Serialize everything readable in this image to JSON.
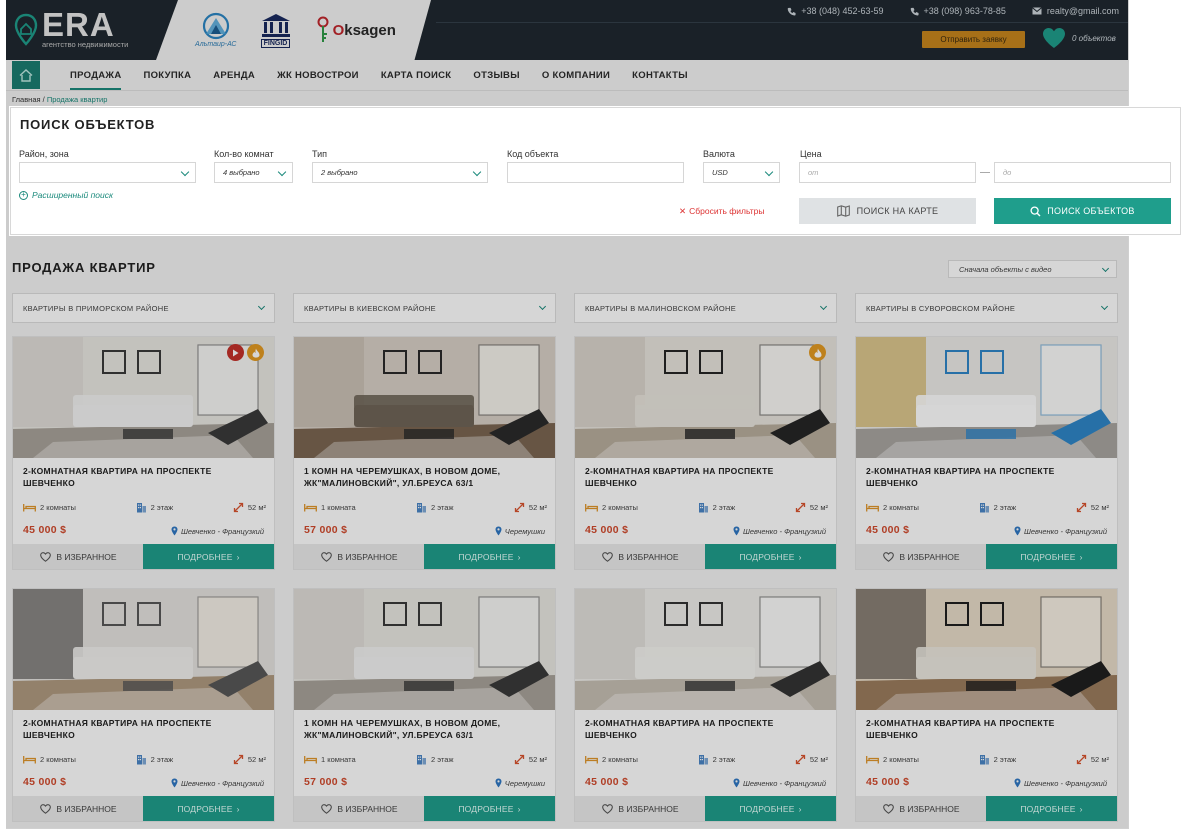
{
  "header": {
    "logo_word": "ERA",
    "logo_sub": "агентство недвижимости",
    "partners": [
      {
        "name": "Альтаир-АС"
      },
      {
        "name": "FINGID"
      },
      {
        "name": "Oksagen"
      }
    ],
    "contacts": [
      {
        "icon": "phone-icon",
        "text": "+38 (048) 452-63-59"
      },
      {
        "icon": "phone-icon",
        "text": "+38 (098) 963-78-85"
      },
      {
        "icon": "mail-icon",
        "text": "realty@gmail.com"
      }
    ],
    "request_button": "Отправить заявку",
    "favorites_count": "0 объектов"
  },
  "nav": {
    "items": [
      "ПРОДАЖА",
      "ПОКУПКА",
      "АРЕНДА",
      "ЖК НОВОСТРОИ",
      "КАРТА ПОИСК",
      "ОТЗЫВЫ",
      "О КОМПАНИИ",
      "КОНТАКТЫ"
    ],
    "active_index": 0
  },
  "breadcrumbs": {
    "home": "Главная",
    "sep": "/",
    "current": "Продажа квартир"
  },
  "search": {
    "title": "ПОИСК ОБЪЕКТОВ",
    "district_label": "Район, зона",
    "district_value": "",
    "rooms_label": "Кол-во комнат",
    "rooms_value": "4 выбрано",
    "type_label": "Тип",
    "type_value": "2 выбрано",
    "code_label": "Код объекта",
    "code_value": "",
    "currency_label": "Валюта",
    "currency_value": "USD",
    "price_label": "Цена",
    "price_from_placeholder": "от",
    "price_to_placeholder": "до",
    "advanced_link": "Расширенный поиск",
    "reset_link": "Сбросить  фильтры",
    "map_button": "ПОИСК НА КАРТЕ",
    "find_button": "ПОИСК ОБЪЕКТОВ"
  },
  "listing": {
    "title": "ПРОДАЖА КВАРТИР",
    "sort_value": "Сначала объекты с видео",
    "districts": [
      "КВАРТИРЫ В ПРИМОРСКОМ РАЙОНЕ",
      "КВАРТИРЫ В КИЕВСКОМ РАЙОНЕ",
      "КВАРТИРЫ В МАЛИНОВСКОМ РАЙОНЕ",
      "КВАРТИРЫ В СУВОРОВСКОМ РАЙОНЕ"
    ],
    "fav_button": "В ИЗБРАННОЕ",
    "more_button": "ПОДРОБНЕЕ",
    "cards": [
      {
        "title": "2-КОМНАТНАЯ КВАРТИРА НА ПРОСПЕКТЕ ШЕВЧЕНКО",
        "rooms": "2 комнаты",
        "floor": "2 этаж",
        "area": "52 м²",
        "price": "45 000 $",
        "location": "Шевченко - Французкий",
        "badges": [
          "video-icon",
          "hot-icon"
        ],
        "scene": "a"
      },
      {
        "title": "1 КОМН НА ЧЕРЕМУШКАХ, В НОВОМ ДОМЕ, ЖК\"МАЛИНОВСКИЙ\", УЛ.БРЕУСА 63/1",
        "rooms": "1 комната",
        "floor": "2 этаж",
        "area": "52 м²",
        "price": "57 000 $",
        "location": "Черемушки",
        "badges": [],
        "scene": "b"
      },
      {
        "title": "2-КОМНАТНАЯ КВАРТИРА НА ПРОСПЕКТЕ ШЕВЧЕНКО",
        "rooms": "2 комнаты",
        "floor": "2 этаж",
        "area": "52 м²",
        "price": "45 000 $",
        "location": "Шевченко - Французкий",
        "badges": [
          "hot-icon"
        ],
        "scene": "c"
      },
      {
        "title": "2-КОМНАТНАЯ КВАРТИРА НА ПРОСПЕКТЕ ШЕВЧЕНКО",
        "rooms": "2 комнаты",
        "floor": "2 этаж",
        "area": "52 м²",
        "price": "45 000 $",
        "location": "Шевченко - Французкий",
        "badges": [],
        "scene": "d"
      },
      {
        "title": "2-КОМНАТНАЯ КВАРТИРА НА ПРОСПЕКТЕ ШЕВЧЕНКО",
        "rooms": "2 комнаты",
        "floor": "2 этаж",
        "area": "52 м²",
        "price": "45 000 $",
        "location": "Шевченко - Французкий",
        "badges": [],
        "scene": "e"
      },
      {
        "title": "1 КОМН НА ЧЕРЕМУШКАХ, В НОВОМ ДОМЕ, ЖК\"МАЛИНОВСКИЙ\", УЛ.БРЕУСА 63/1",
        "rooms": "1 комната",
        "floor": "2 этаж",
        "area": "52 м²",
        "price": "57 000 $",
        "location": "Черемушки",
        "badges": [],
        "scene": "a"
      },
      {
        "title": "2-КОМНАТНАЯ КВАРТИРА НА ПРОСПЕКТЕ ШЕВЧЕНКО",
        "rooms": "2 комнаты",
        "floor": "2 этаж",
        "area": "52 м²",
        "price": "45 000 $",
        "location": "Шевченко - Французкий",
        "badges": [],
        "scene": "f"
      },
      {
        "title": "2-КОМНАТНАЯ КВАРТИРА НА ПРОСПЕКТЕ ШЕВЧЕНКО",
        "rooms": "2 комнаты",
        "floor": "2 этаж",
        "area": "52 м²",
        "price": "45 000 $",
        "location": "Шевченко - Французкий",
        "badges": [],
        "scene": "g"
      }
    ]
  },
  "colors": {
    "accent": "#1f9e8c",
    "header_bg": "#1f2830",
    "price": "#d24a2d",
    "request_btn": "#c7861d"
  }
}
